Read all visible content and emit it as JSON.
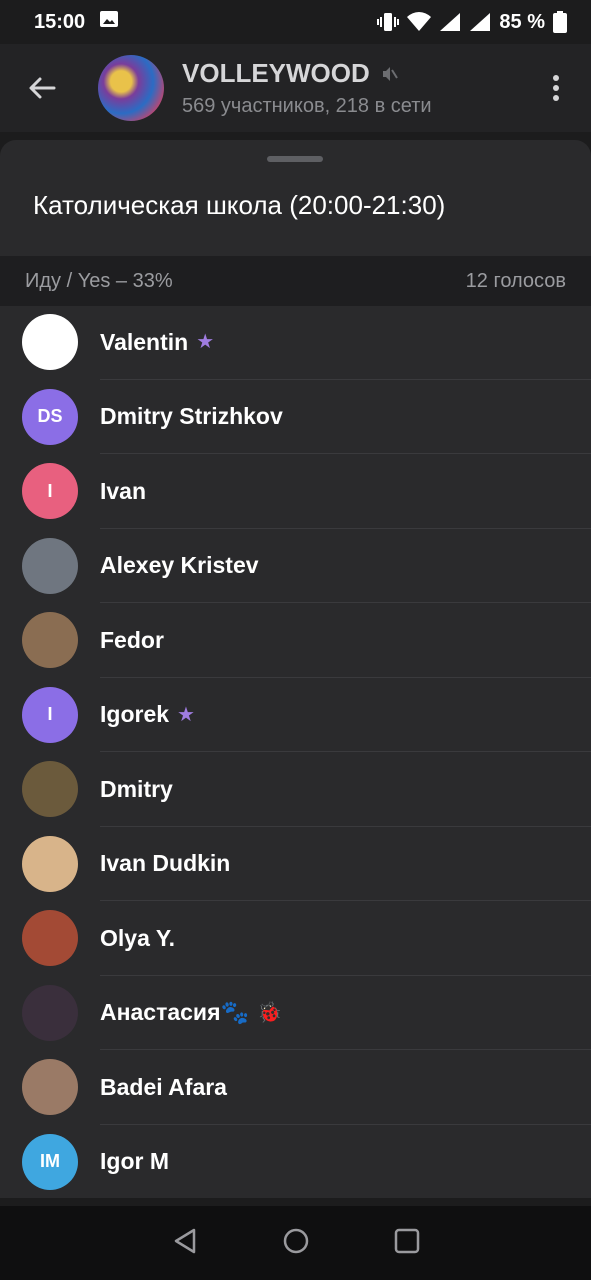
{
  "status_bar": {
    "time": "15:00",
    "battery": "85 %"
  },
  "chat": {
    "title": "VOLLEYWOOD",
    "subtitle": "569 участников, 218 в сети"
  },
  "poll": {
    "option_title": "Католическая школа (20:00-21:30)",
    "option_label": "Иду / Yes – 33%",
    "votes_count": "12 голосов"
  },
  "voters": [
    {
      "name": "Valentin",
      "initials": "",
      "avatar_color": "#ffffff",
      "badge": "★"
    },
    {
      "name": "Dmitry Strizhkov",
      "initials": "DS",
      "avatar_color": "#8b6ee6",
      "badge": ""
    },
    {
      "name": "Ivan",
      "initials": "I",
      "avatar_color": "#e8607f",
      "badge": ""
    },
    {
      "name": "Alexey Kristev",
      "initials": "",
      "avatar_color": "#6f7680",
      "badge": ""
    },
    {
      "name": "Fedor",
      "initials": "",
      "avatar_color": "#8a6d52",
      "badge": ""
    },
    {
      "name": "Igorek",
      "initials": "I",
      "avatar_color": "#8b6ee6",
      "badge": "★"
    },
    {
      "name": "Dmitry",
      "initials": "",
      "avatar_color": "#6b5a3c",
      "badge": ""
    },
    {
      "name": "Ivan Dudkin",
      "initials": "",
      "avatar_color": "#d8b48a",
      "badge": ""
    },
    {
      "name": "Olya Y.",
      "initials": "",
      "avatar_color": "#a34a35",
      "badge": ""
    },
    {
      "name": "Анастасия🐾",
      "initials": "",
      "avatar_color": "#3a2f3c",
      "badge": "🐞"
    },
    {
      "name": "Badei Afara",
      "initials": "",
      "avatar_color": "#9a7a66",
      "badge": ""
    },
    {
      "name": "Igor M",
      "initials": "IM",
      "avatar_color": "#3fa7e0",
      "badge": ""
    }
  ],
  "colors": {
    "background": "#1c1c1d",
    "sheet": "#2a2a2c",
    "accent_star": "#9f7ce0"
  }
}
